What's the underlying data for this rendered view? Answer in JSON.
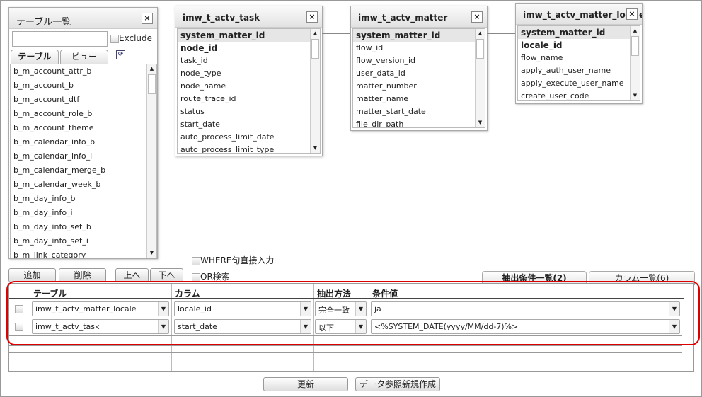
{
  "table_panel": {
    "title": "テーブル一覧",
    "search_value": "",
    "exclude_label": "Exclude",
    "tabs": [
      "テーブル",
      "ビュー"
    ],
    "items": [
      "b_m_account_attr_b",
      "b_m_account_b",
      "b_m_account_dtf",
      "b_m_account_role_b",
      "b_m_account_theme",
      "b_m_calendar_info_b",
      "b_m_calendar_info_i",
      "b_m_calendar_merge_b",
      "b_m_calendar_week_b",
      "b_m_day_info_b",
      "b_m_day_info_i",
      "b_m_day_info_set_b",
      "b_m_day_info_set_i",
      "b_m_link_category"
    ]
  },
  "entities": [
    {
      "title": "imw_t_actv_task",
      "columns": [
        "system_matter_id",
        "node_id",
        "task_id",
        "node_type",
        "node_name",
        "route_trace_id",
        "status",
        "start_date",
        "auto_process_limit_date",
        "auto_process_limit_type"
      ]
    },
    {
      "title": "imw_t_actv_matter",
      "columns": [
        "system_matter_id",
        "flow_id",
        "flow_version_id",
        "user_data_id",
        "matter_number",
        "matter_name",
        "matter_start_date",
        "file_dir_path"
      ]
    },
    {
      "title": "imw_t_actv_matter_locale",
      "columns": [
        "system_matter_id",
        "locale_id",
        "flow_name",
        "apply_auth_user_name",
        "apply_execute_user_name",
        "create_user_code"
      ]
    }
  ],
  "options": {
    "where_direct": "WHERE句直接入力",
    "or_search": "OR検索"
  },
  "toolbar": {
    "add": "追加",
    "delete": "削除",
    "up": "上へ",
    "down": "下へ"
  },
  "tabs": {
    "conditions": "抽出条件一覧(2)",
    "columns": "カラム一覧(6)"
  },
  "grid": {
    "headers": [
      "テーブル",
      "カラム",
      "抽出方法",
      "条件値"
    ],
    "rows": [
      {
        "table": "imw_t_actv_matter_locale",
        "column": "locale_id",
        "method": "完全一致",
        "value": "ja"
      },
      {
        "table": "imw_t_actv_task",
        "column": "start_date",
        "method": "以下",
        "value": "<%SYSTEM_DATE(yyyy/MM/dd-7)%>"
      }
    ]
  },
  "footer": {
    "update": "更新",
    "create": "データ参照新規作成"
  }
}
